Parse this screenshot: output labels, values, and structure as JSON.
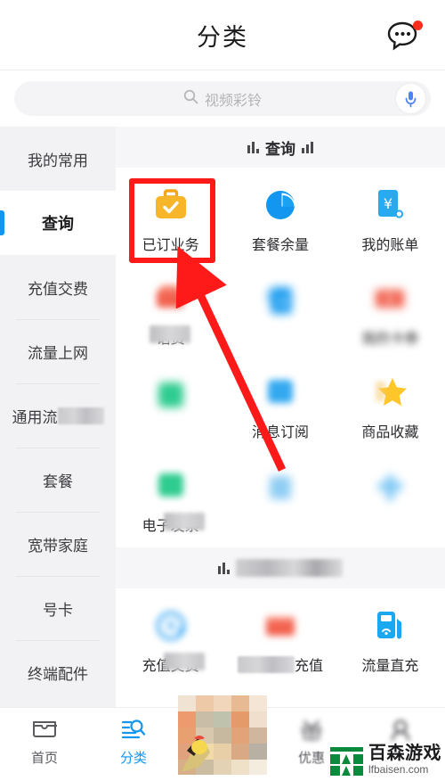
{
  "header": {
    "title": "分类",
    "chat_icon": "chat-bubble-icon",
    "badge_color": "#fb2c1d"
  },
  "search": {
    "placeholder": "视频彩铃",
    "search_icon": "search-icon",
    "mic_icon": "microphone-icon"
  },
  "sidebar": {
    "items": [
      {
        "label": "我的常用",
        "active": false,
        "blurred": false
      },
      {
        "label": "查询",
        "active": true,
        "blurred": false
      },
      {
        "label": "充值交费",
        "active": false,
        "blurred": false
      },
      {
        "label": "流量上网",
        "active": false,
        "blurred": false
      },
      {
        "label": "通用流",
        "active": false,
        "blurred": true
      },
      {
        "label": "套餐",
        "active": false,
        "blurred": false
      },
      {
        "label": "宽带家庭",
        "active": false,
        "blurred": false
      },
      {
        "label": "号卡",
        "active": false,
        "blurred": false
      },
      {
        "label": "终端配件",
        "active": false,
        "blurred": false
      }
    ],
    "active_indicator_color": "#1296f0"
  },
  "content": {
    "sections": [
      {
        "title": "查询",
        "title_blurred": false,
        "tiles": [
          {
            "label": "已订业务",
            "icon": "briefcase-check-icon",
            "color": "#f5a623",
            "blur": "none",
            "highlighted": true
          },
          {
            "label": "套餐余量",
            "icon": "pie-chart-icon",
            "color": "#1296f0",
            "blur": "none",
            "highlighted": false
          },
          {
            "label": "我的账单",
            "icon": "receipt-yuan-icon",
            "color": "#29a9ee",
            "blur": "none",
            "highlighted": false
          },
          {
            "label": "话费",
            "icon": "wallet-icon",
            "color": "#f2614e",
            "blur": "label",
            "highlighted": false
          },
          {
            "label": "",
            "icon": "notebook-yuan-icon",
            "color": "#1e9ef0",
            "blur": "full",
            "highlighted": false
          },
          {
            "label": "我的卡券",
            "icon": "coupon-yuan-icon",
            "color": "#f2614e",
            "blur": "full",
            "highlighted": false
          },
          {
            "label": "",
            "icon": "green-square-icon",
            "color": "#2dcc8f",
            "blur": "full",
            "highlighted": false
          },
          {
            "label": "消息订阅",
            "icon": "message-subscribe-icon",
            "color": "#33a9f0",
            "blur": "icon",
            "highlighted": false
          },
          {
            "label": "商品收藏",
            "icon": "star-icon",
            "color": "#ffc629",
            "blur": "none",
            "highlighted": false
          },
          {
            "label": "电子发票",
            "icon": "invoice-icon",
            "color": "#2dcc8f",
            "blur": "label",
            "highlighted": false
          },
          {
            "label": "",
            "icon": "blue-square-icon",
            "color": "#8fcdf4",
            "blur": "full",
            "highlighted": false
          },
          {
            "label": "",
            "icon": "blue-cross-icon",
            "color": "#7fc8f5",
            "blur": "full",
            "highlighted": false
          }
        ]
      },
      {
        "title": "充值交费",
        "title_blurred": true,
        "tiles": [
          {
            "label": "充值交费",
            "icon": "yuan-refresh-icon",
            "color": "#1296f0",
            "blur": "label",
            "highlighted": false
          },
          {
            "label": "充值",
            "icon": "card-recharge-icon",
            "color": "#f2614e",
            "blur": "label-left",
            "highlighted": false
          },
          {
            "label": "流量直充",
            "icon": "fuel-wifi-icon",
            "color": "#1aa9f0",
            "blur": "none",
            "highlighted": false
          }
        ]
      }
    ]
  },
  "annotation": {
    "highlight_color": "#ff1a1a",
    "arrow_color": "#ff1a1a",
    "target": "已订业务"
  },
  "bottom_nav": {
    "items": [
      {
        "label": "首页",
        "icon": "home-icon",
        "active": false,
        "blurred": false
      },
      {
        "label": "分类",
        "icon": "category-search-icon",
        "active": true,
        "blurred": false
      },
      {
        "label": "",
        "icon": "center-promo-image",
        "active": false,
        "blurred": true
      },
      {
        "label": "优惠",
        "icon": "tag-discount-icon",
        "active": false,
        "blurred": true
      },
      {
        "label": "",
        "icon": "person-icon",
        "active": false,
        "blurred": true
      }
    ],
    "active_color": "#1296f0"
  },
  "watermark": {
    "main_text": "百森游戏",
    "sub_text": "lfbaisen.com",
    "logo_color": "#0a8a3c"
  }
}
